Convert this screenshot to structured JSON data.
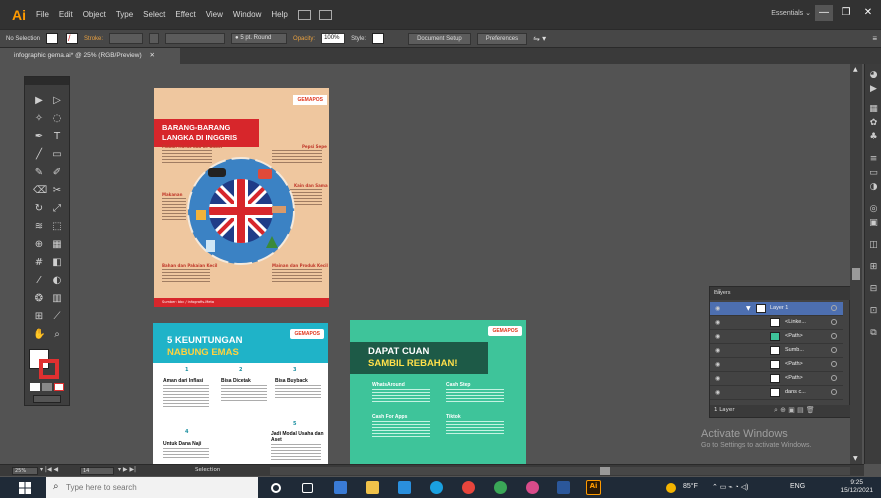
{
  "app": {
    "logo": "Ai"
  },
  "menu": [
    "File",
    "Edit",
    "Object",
    "Type",
    "Select",
    "Effect",
    "View",
    "Window",
    "Help"
  ],
  "workspace": {
    "label": "Essentials",
    "chevron": "⌄"
  },
  "window_controls": {
    "minimize": "—",
    "restore": "❐",
    "close": "✕"
  },
  "control_bar": {
    "selection": "No Selection",
    "stroke_label": "Stroke:",
    "brush": "5 pt. Round",
    "opacity_label": "Opacity:",
    "opacity_value": "100%",
    "style_label": "Style:",
    "document_setup": "Document Setup",
    "preferences": "Preferences"
  },
  "document_tab": {
    "title": "infographic gema.ai* @ 25% (RGB/Preview)",
    "close": "✕"
  },
  "artboard1": {
    "logo": "GEMAPOS",
    "title_line1": "BARANG-BARANG",
    "title_line2": "LANGKA DI INGGRIS",
    "footer": "Sumber: bbc / infografis-Meta",
    "labels": [
      "Makan Harus dua ke Babor",
      "Makanan",
      "Kain dan Sama",
      "Pepsi Sepe",
      "Bahan dan Pakaian Kecil",
      "Mainan dan Produk Kecil"
    ]
  },
  "artboard2": {
    "logo": "GEMAPOS",
    "title_line1": "5 KEUNTUNGAN",
    "title_line2": "NABUNG EMAS",
    "items": [
      {
        "num": "1",
        "title": "Aman dari Inflasi"
      },
      {
        "num": "2",
        "title": "Bisa Dicetak"
      },
      {
        "num": "3",
        "title": "Bisa Buyback"
      },
      {
        "num": "4",
        "title": "Untuk Dana Naji"
      },
      {
        "num": "5",
        "title": "Jadi Modal Usaha dan Aset"
      }
    ]
  },
  "artboard3": {
    "logo": "GEMAPOS",
    "title_line1": "DAPAT CUAN",
    "title_line2": "SAMBIL REBAHAN!",
    "items": [
      "WhatsAround",
      "Cash Step",
      "Cash For Apps",
      "Tiktok"
    ]
  },
  "layers_panel": {
    "tab": "Layers",
    "rows": [
      "Layer 1",
      "<Linke...",
      "<Path>",
      "Sumb...",
      "<Path>",
      "<Path>",
      "dans c..."
    ],
    "footer": "1 Layer"
  },
  "watermark": {
    "line1": "Activate Windows",
    "line2": "Go to Settings to activate Windows."
  },
  "status_bar": {
    "zoom": "25%",
    "page": "14",
    "status": "Selection"
  },
  "taskbar": {
    "search_placeholder": "Type here to search",
    "weather": "85°F",
    "language": "ENG",
    "time": "9:25",
    "date": "15/12/2021"
  },
  "colors": {
    "accent_orange": "#ff9a00",
    "ab1_bg": "#efc79f",
    "red": "#d7262b",
    "teal": "#1fb3c8",
    "green": "#3ec49a"
  }
}
